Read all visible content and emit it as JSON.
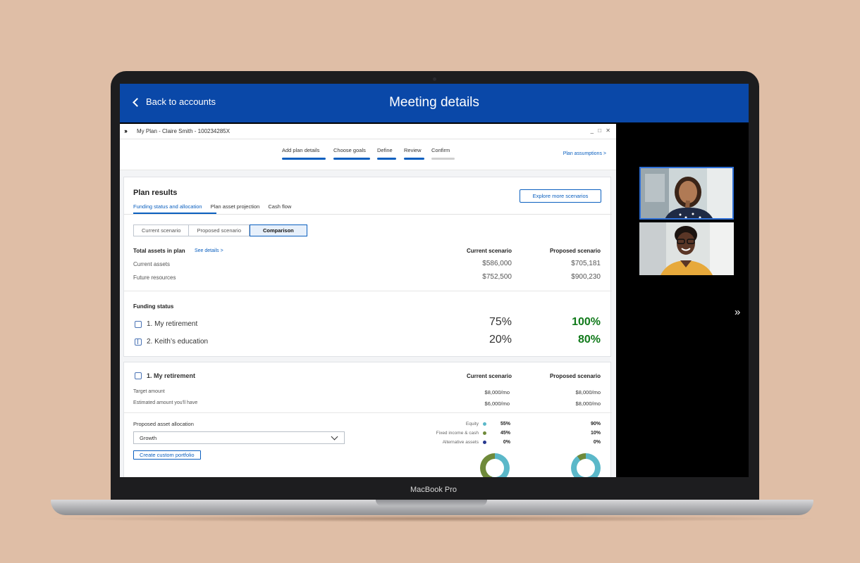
{
  "device": {
    "label": "MacBook Pro"
  },
  "header": {
    "back_label": "Back to accounts",
    "title": "Meeting details"
  },
  "window": {
    "title": "My Plan - Claire Smith - 100234285X",
    "controls": "_ □ ✕"
  },
  "steps": [
    "Add plan details",
    "Choose goals",
    "Define",
    "Review",
    "Confirm"
  ],
  "plan_assumptions": "Plan assumptions >",
  "plan_results": {
    "title": "Plan results",
    "tabs": [
      "Funding status and allocation",
      "Plan asset projection",
      "Cash flow"
    ],
    "explore_button": "Explore more scenarios",
    "scenario_toggle": [
      "Current scenario",
      "Proposed scenario",
      "Comparison"
    ],
    "assets": {
      "title": "Total assets in plan",
      "see_details": "See details >",
      "col_current": "Current scenario",
      "col_proposed": "Proposed scenario",
      "rows": [
        {
          "label": "Current assets",
          "current": "$586,000",
          "proposed": "$705,181"
        },
        {
          "label": "Future resources",
          "current": "$752,500",
          "proposed": "$900,230"
        }
      ]
    },
    "funding": {
      "title": "Funding status",
      "goals": [
        {
          "label": "1. My retirement",
          "current": "75%",
          "proposed": "100%"
        },
        {
          "label": "2. Keith’s education",
          "current": "20%",
          "proposed": "80%"
        }
      ]
    }
  },
  "retirement": {
    "title": "1. My retirement",
    "col_current": "Current scenario",
    "col_proposed": "Proposed scenario",
    "rows": [
      {
        "label": "Target amount",
        "current": "$8,000/mo",
        "proposed": "$8,000/mo"
      },
      {
        "label": "Estimated amount you'll have",
        "current": "$6,000/mo",
        "proposed": "$8,000/mo"
      }
    ],
    "allocation_label": "Proposed asset allocation",
    "allocation_value": "Growth",
    "custom_button": "Create custom portfolio",
    "allocation": [
      {
        "name": "Equity",
        "current": "55%",
        "proposed": "90%",
        "color": "#5bb8c9"
      },
      {
        "name": "Fixed income & cash",
        "current": "45%",
        "proposed": "10%",
        "color": "#6f8a3a"
      },
      {
        "name": "Alternative assets",
        "current": "0%",
        "proposed": "0%",
        "color": "#27388f"
      }
    ]
  },
  "colors": {
    "brand": "#0a48a8",
    "accent": "#0a5fbf",
    "positive": "#117a1b"
  }
}
